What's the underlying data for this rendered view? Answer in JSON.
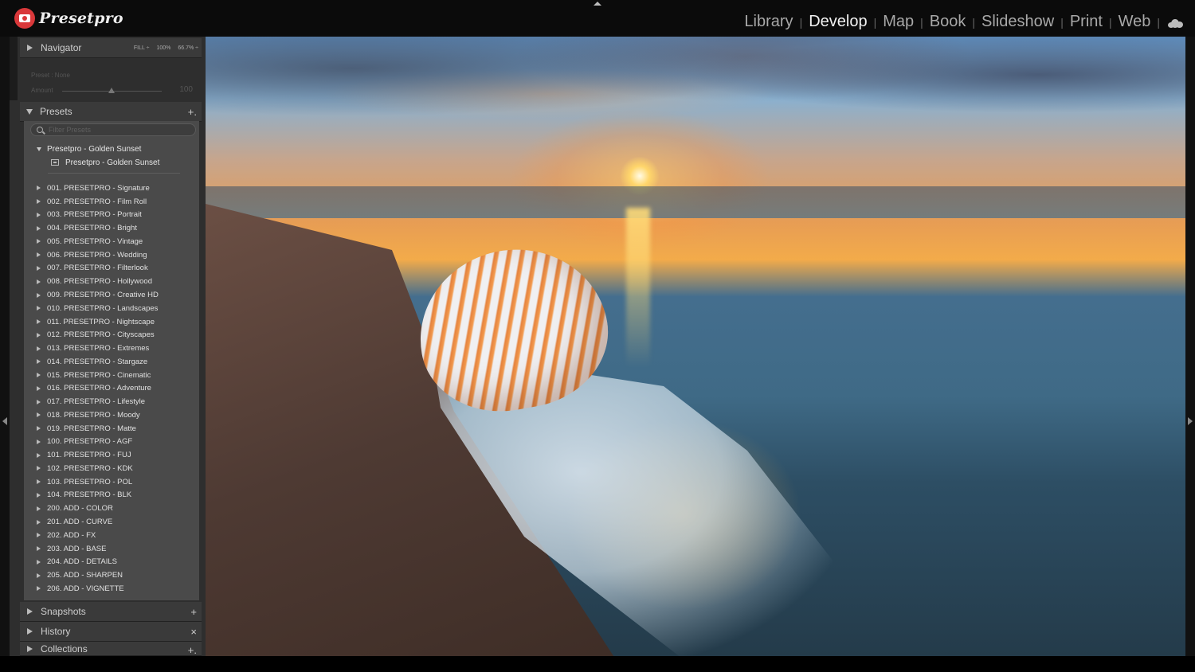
{
  "brand": {
    "name": "Presetpro"
  },
  "modules": {
    "items": [
      "Library",
      "Develop",
      "Map",
      "Book",
      "Slideshow",
      "Print",
      "Web"
    ],
    "active": "Develop",
    "separator": "|"
  },
  "navigator": {
    "title": "Navigator",
    "options": [
      "FILL ÷",
      "100%",
      "66.7% ÷"
    ]
  },
  "preset_amount": {
    "preset_label": "Preset : None",
    "amount_label": "Amount",
    "amount_value": "100"
  },
  "presets": {
    "title": "Presets",
    "add_label": "+.",
    "filter_placeholder": "Filter Presets",
    "open_group": {
      "name": "Presetpro - Golden Sunset",
      "items": [
        "Presetpro - Golden Sunset"
      ]
    },
    "folders": [
      "001. PRESETPRO - Signature",
      "002. PRESETPRO - Film Roll",
      "003. PRESETPRO - Portrait",
      "004. PRESETPRO - Bright",
      "005. PRESETPRO - Vintage",
      "006. PRESETPRO - Wedding",
      "007. PRESETPRO - Filterlook",
      "008. PRESETPRO - Hollywood",
      "009. PRESETPRO - Creative HD",
      "010. PRESETPRO - Landscapes",
      "011. PRESETPRO - Nightscape",
      "012. PRESETPRO - Cityscapes",
      "013. PRESETPRO - Extremes",
      "014. PRESETPRO - Stargaze",
      "015. PRESETPRO - Cinematic",
      "016. PRESETPRO - Adventure",
      "017. PRESETPRO - Lifestyle",
      "018. PRESETPRO - Moody",
      "019. PRESETPRO - Matte",
      "100. PRESETPRO - AGF",
      "101. PRESETPRO - FUJ",
      "102. PRESETPRO - KDK",
      "103. PRESETPRO - POL",
      "104. PRESETPRO - BLK",
      "200. ADD - COLOR",
      "201. ADD - CURVE",
      "202. ADD - FX",
      "203. ADD - BASE",
      "204. ADD - DETAILS",
      "205. ADD - SHARPEN",
      "206. ADD - VIGNETTE"
    ]
  },
  "snapshots": {
    "title": "Snapshots",
    "action": "+"
  },
  "history": {
    "title": "History",
    "action": "×"
  },
  "collections": {
    "title": "Collections",
    "action": "+."
  },
  "colors": {
    "brand_red": "#d9383a",
    "panel_bg": "#2e2e2e",
    "presets_bg": "#4a4a4a"
  },
  "icons": [
    "camera-logo-icon",
    "cloud-icon",
    "search-icon",
    "preset-document-icon",
    "disclosure-triangle-icon"
  ]
}
